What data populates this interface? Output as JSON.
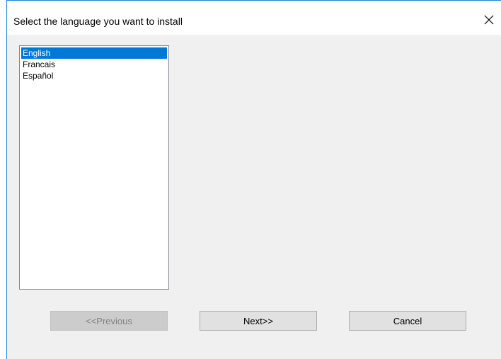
{
  "window": {
    "title": "Select the language you want to install",
    "accent_color": "#1883d7"
  },
  "language_list": {
    "items": [
      {
        "label": "English",
        "selected": true
      },
      {
        "label": "Francais",
        "selected": false
      },
      {
        "label": "Español",
        "selected": false
      }
    ],
    "selection_color": "#0078d7"
  },
  "buttons": {
    "previous_label": "<<Previous",
    "previous_enabled": false,
    "next_label": "Next>>",
    "cancel_label": "Cancel"
  },
  "icons": {
    "close": "close-icon"
  }
}
